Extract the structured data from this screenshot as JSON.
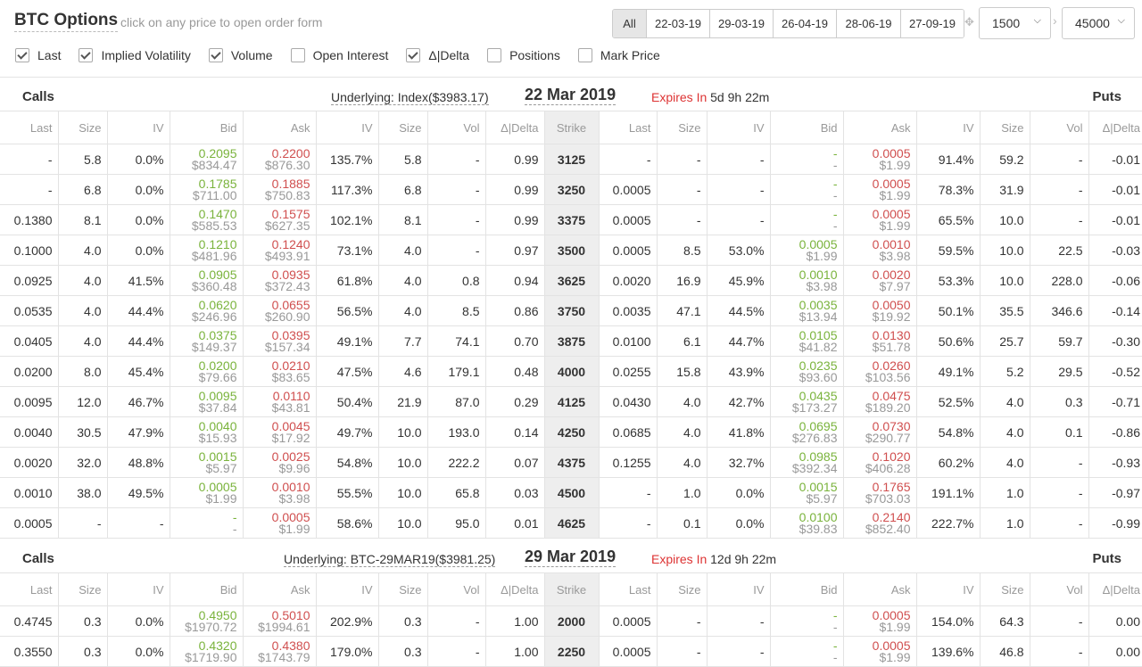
{
  "header": {
    "title": "BTC Options",
    "hint": "click on any price to open order form",
    "expiry_filters": [
      "All",
      "22-03-19",
      "29-03-19",
      "26-04-19",
      "28-06-19",
      "27-09-19"
    ],
    "strike_min": "1500",
    "strike_max": "45000"
  },
  "checkboxes": [
    {
      "label": "Last",
      "checked": true
    },
    {
      "label": "Implied Volatility",
      "checked": true
    },
    {
      "label": "Volume",
      "checked": true
    },
    {
      "label": "Open Interest",
      "checked": false
    },
    {
      "label": "Δ|Delta",
      "checked": true
    },
    {
      "label": "Positions",
      "checked": false
    },
    {
      "label": "Mark Price",
      "checked": false
    }
  ],
  "columns": [
    "Last",
    "Size",
    "IV",
    "Bid",
    "Ask",
    "IV",
    "Size",
    "Vol",
    "Δ|Delta",
    "Strike",
    "Last",
    "Size",
    "IV",
    "Bid",
    "Ask",
    "IV",
    "Size",
    "Vol",
    "Δ|Delta"
  ],
  "colors": {
    "bid": "#7ab33c",
    "ask": "#d04f4f",
    "expires": "#dd3333"
  },
  "sections": [
    {
      "calls_label": "Calls",
      "puts_label": "Puts",
      "underlying": "Underlying: Index($3983.17)",
      "date": "22 Mar 2019",
      "expires_label": "Expires In",
      "expires_value": "5d 9h 22m",
      "rows": [
        [
          "-",
          "5.8",
          "0.0%",
          [
            "0.2095",
            "$834.47"
          ],
          [
            "0.2200",
            "$876.30"
          ],
          "135.7%",
          "5.8",
          "-",
          "0.99",
          "3125",
          "-",
          "-",
          "-",
          [
            "-",
            "-"
          ],
          [
            "0.0005",
            "$1.99"
          ],
          "91.4%",
          "59.2",
          "-",
          "-0.01"
        ],
        [
          "-",
          "6.8",
          "0.0%",
          [
            "0.1785",
            "$711.00"
          ],
          [
            "0.1885",
            "$750.83"
          ],
          "117.3%",
          "6.8",
          "-",
          "0.99",
          "3250",
          "0.0005",
          "-",
          "-",
          [
            "-",
            "-"
          ],
          [
            "0.0005",
            "$1.99"
          ],
          "78.3%",
          "31.9",
          "-",
          "-0.01"
        ],
        [
          "0.1380",
          "8.1",
          "0.0%",
          [
            "0.1470",
            "$585.53"
          ],
          [
            "0.1575",
            "$627.35"
          ],
          "102.1%",
          "8.1",
          "-",
          "0.99",
          "3375",
          "0.0005",
          "-",
          "-",
          [
            "-",
            "-"
          ],
          [
            "0.0005",
            "$1.99"
          ],
          "65.5%",
          "10.0",
          "-",
          "-0.01"
        ],
        [
          "0.1000",
          "4.0",
          "0.0%",
          [
            "0.1210",
            "$481.96"
          ],
          [
            "0.1240",
            "$493.91"
          ],
          "73.1%",
          "4.0",
          "-",
          "0.97",
          "3500",
          "0.0005",
          "8.5",
          "53.0%",
          [
            "0.0005",
            "$1.99"
          ],
          [
            "0.0010",
            "$3.98"
          ],
          "59.5%",
          "10.0",
          "22.5",
          "-0.03"
        ],
        [
          "0.0925",
          "4.0",
          "41.5%",
          [
            "0.0905",
            "$360.48"
          ],
          [
            "0.0935",
            "$372.43"
          ],
          "61.8%",
          "4.0",
          "0.8",
          "0.94",
          "3625",
          "0.0020",
          "16.9",
          "45.9%",
          [
            "0.0010",
            "$3.98"
          ],
          [
            "0.0020",
            "$7.97"
          ],
          "53.3%",
          "10.0",
          "228.0",
          "-0.06"
        ],
        [
          "0.0535",
          "4.0",
          "44.4%",
          [
            "0.0620",
            "$246.96"
          ],
          [
            "0.0655",
            "$260.90"
          ],
          "56.5%",
          "4.0",
          "8.5",
          "0.86",
          "3750",
          "0.0035",
          "47.1",
          "44.5%",
          [
            "0.0035",
            "$13.94"
          ],
          [
            "0.0050",
            "$19.92"
          ],
          "50.1%",
          "35.5",
          "346.6",
          "-0.14"
        ],
        [
          "0.0405",
          "4.0",
          "44.4%",
          [
            "0.0375",
            "$149.37"
          ],
          [
            "0.0395",
            "$157.34"
          ],
          "49.1%",
          "7.7",
          "74.1",
          "0.70",
          "3875",
          "0.0100",
          "6.1",
          "44.7%",
          [
            "0.0105",
            "$41.82"
          ],
          [
            "0.0130",
            "$51.78"
          ],
          "50.6%",
          "25.7",
          "59.7",
          "-0.30"
        ],
        [
          "0.0200",
          "8.0",
          "45.4%",
          [
            "0.0200",
            "$79.66"
          ],
          [
            "0.0210",
            "$83.65"
          ],
          "47.5%",
          "4.6",
          "179.1",
          "0.48",
          "4000",
          "0.0255",
          "15.8",
          "43.9%",
          [
            "0.0235",
            "$93.60"
          ],
          [
            "0.0260",
            "$103.56"
          ],
          "49.1%",
          "5.2",
          "29.5",
          "-0.52"
        ],
        [
          "0.0095",
          "12.0",
          "46.7%",
          [
            "0.0095",
            "$37.84"
          ],
          [
            "0.0110",
            "$43.81"
          ],
          "50.4%",
          "21.9",
          "87.0",
          "0.29",
          "4125",
          "0.0430",
          "4.0",
          "42.7%",
          [
            "0.0435",
            "$173.27"
          ],
          [
            "0.0475",
            "$189.20"
          ],
          "52.5%",
          "4.0",
          "0.3",
          "-0.71"
        ],
        [
          "0.0040",
          "30.5",
          "47.9%",
          [
            "0.0040",
            "$15.93"
          ],
          [
            "0.0045",
            "$17.92"
          ],
          "49.7%",
          "10.0",
          "193.0",
          "0.14",
          "4250",
          "0.0685",
          "4.0",
          "41.8%",
          [
            "0.0695",
            "$276.83"
          ],
          [
            "0.0730",
            "$290.77"
          ],
          "54.8%",
          "4.0",
          "0.1",
          "-0.86"
        ],
        [
          "0.0020",
          "32.0",
          "48.8%",
          [
            "0.0015",
            "$5.97"
          ],
          [
            "0.0025",
            "$9.96"
          ],
          "54.8%",
          "10.0",
          "222.2",
          "0.07",
          "4375",
          "0.1255",
          "4.0",
          "32.7%",
          [
            "0.0985",
            "$392.34"
          ],
          [
            "0.1020",
            "$406.28"
          ],
          "60.2%",
          "4.0",
          "-",
          "-0.93"
        ],
        [
          "0.0010",
          "38.0",
          "49.5%",
          [
            "0.0005",
            "$1.99"
          ],
          [
            "0.0010",
            "$3.98"
          ],
          "55.5%",
          "10.0",
          "65.8",
          "0.03",
          "4500",
          "-",
          "1.0",
          "0.0%",
          [
            "0.0015",
            "$5.97"
          ],
          [
            "0.1765",
            "$703.03"
          ],
          "191.1%",
          "1.0",
          "-",
          "-0.97"
        ],
        [
          "0.0005",
          "-",
          "-",
          [
            "-",
            "-"
          ],
          [
            "0.0005",
            "$1.99"
          ],
          "58.6%",
          "10.0",
          "95.0",
          "0.01",
          "4625",
          "-",
          "0.1",
          "0.0%",
          [
            "0.0100",
            "$39.83"
          ],
          [
            "0.2140",
            "$852.40"
          ],
          "222.7%",
          "1.0",
          "-",
          "-0.99"
        ]
      ]
    },
    {
      "calls_label": "Calls",
      "puts_label": "Puts",
      "underlying": "Underlying: BTC-29MAR19($3981.25)",
      "date": "29 Mar 2019",
      "expires_label": "Expires In",
      "expires_value": "12d 9h 22m",
      "rows": [
        [
          "0.4745",
          "0.3",
          "0.0%",
          [
            "0.4950",
            "$1970.72"
          ],
          [
            "0.5010",
            "$1994.61"
          ],
          "202.9%",
          "0.3",
          "-",
          "1.00",
          "2000",
          "0.0005",
          "-",
          "-",
          [
            "-",
            "-"
          ],
          [
            "0.0005",
            "$1.99"
          ],
          "154.0%",
          "64.3",
          "-",
          "0.00"
        ],
        [
          "0.3550",
          "0.3",
          "0.0%",
          [
            "0.4320",
            "$1719.90"
          ],
          [
            "0.4380",
            "$1743.79"
          ],
          "179.0%",
          "0.3",
          "-",
          "1.00",
          "2250",
          "0.0005",
          "-",
          "-",
          [
            "-",
            "-"
          ],
          [
            "0.0005",
            "$1.99"
          ],
          "139.6%",
          "46.8",
          "-",
          "0.00"
        ]
      ]
    }
  ]
}
